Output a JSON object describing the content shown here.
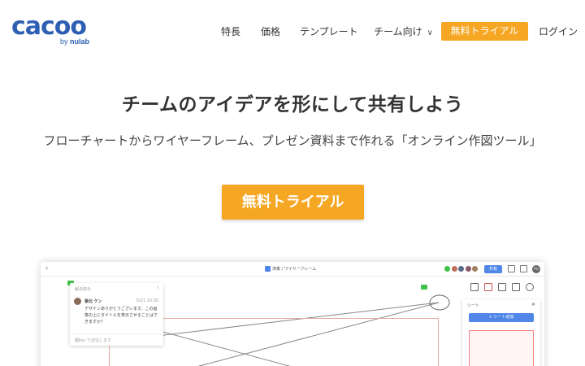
{
  "brand": {
    "logo_text": "cacoo",
    "sub_by": "by",
    "sub_company": "nulab",
    "color": "#2f5fb3"
  },
  "nav": {
    "items": [
      "特長",
      "価格",
      "テンプレート",
      "チーム向け"
    ],
    "team_chevron": "∨",
    "trial_label": "無料トライアル",
    "login_label": "ログイン"
  },
  "hero": {
    "title": "チームのアイデアを形にして共有しよう",
    "subtitle": "フローチャートからワイヤーフレーム、プレゼン資料まで作れる「オンライン作図ツール」",
    "cta_label": "無料トライアル"
  },
  "accent_color": "#f5a623",
  "preview": {
    "back": "‹",
    "doc_title": "演奏 / ワイヤーフレーム",
    "share_label": "共有",
    "user_initials": "PU",
    "comment": {
      "header": "解決済み",
      "author": "栗北 ケン",
      "time": "5/21 10:30",
      "text": "デザインありがとうございます。この画像の上にタイトルを表示させることはできますか？",
      "input_placeholder": "Enter で返信します"
    },
    "sheet_panel": {
      "title": "シート",
      "close": "✕",
      "add_label": "+ シート追加"
    }
  }
}
